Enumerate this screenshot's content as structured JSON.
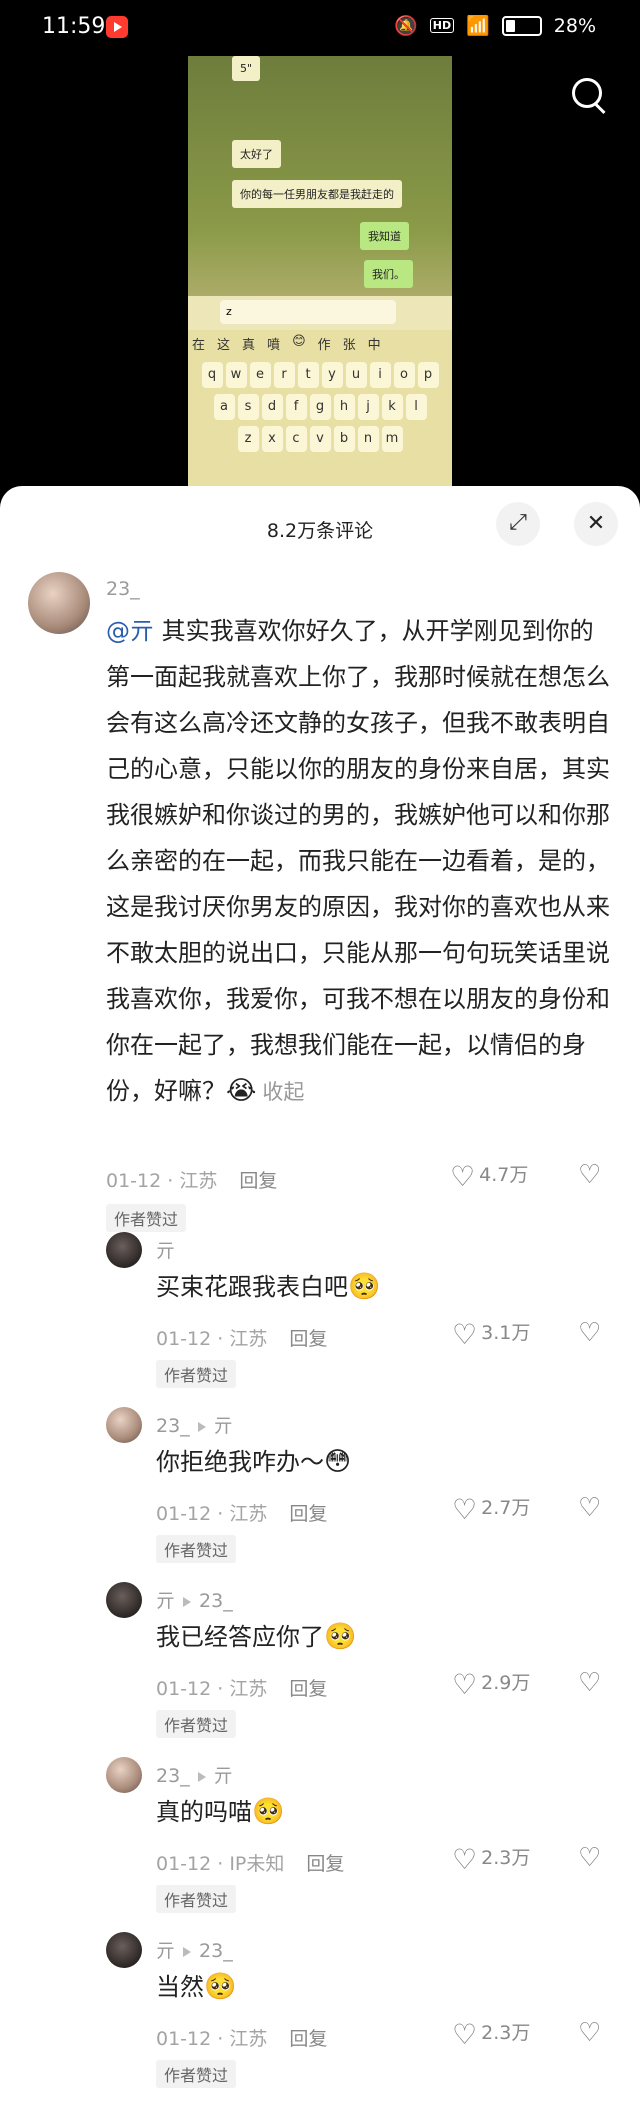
{
  "status": {
    "time": "11:59",
    "battery": "28%"
  },
  "video": {
    "bubbles": [
      "5\"",
      "太好了",
      "你的每一任男朋友都是我赶走的",
      "我知道",
      "我们。"
    ],
    "input_text": "z",
    "candidates": [
      "在",
      "这",
      "真",
      "噴",
      "😊",
      "作",
      "张",
      "中"
    ],
    "keys_row1": [
      "q",
      "w",
      "e",
      "r",
      "t",
      "y",
      "u",
      "i",
      "o",
      "p"
    ],
    "keys_row2": [
      "a",
      "s",
      "d",
      "f",
      "g",
      "h",
      "j",
      "k",
      "l"
    ],
    "keys_row3": [
      "z",
      "x",
      "c",
      "v",
      "b",
      "n",
      "m"
    ]
  },
  "sheet": {
    "title": "8.2万条评论"
  },
  "comments": [
    {
      "user": "23_",
      "mention": "@亓",
      "text": " 其实我喜欢你好久了，从开学刚见到你的第一面起我就喜欢上你了，我那时候就在想怎么会有这么高冷还文静的女孩子，但我不敢表明自己的心意，只能以你的朋友的身份来自居，其实我很嫉妒和你谈过的男的，我嫉妒他可以和你那么亲密的在一起，而我只能在一边看着，是的，这是我讨厌你男友的原因，我对你的喜欢也从来不敢太胆的说出口，只能从那一句句玩笑话里说我喜欢你，我爱你，可我不想在以朋友的身份和你在一起了，我想我们能在一起，以情侣的身份，好嘛？",
      "emoji": "😭",
      "collapse": "收起",
      "meta": "01-12 · 江苏",
      "reply": "回复",
      "likes": "4.7万",
      "badge": "作者赞过"
    }
  ],
  "replies": [
    {
      "user": "亓",
      "to": "",
      "text": "买束花跟我表白吧",
      "emoji": "🥺",
      "meta": "01-12 · 江苏",
      "reply": "回复",
      "likes": "3.1万",
      "badge": "作者赞过"
    },
    {
      "user": "23_",
      "to": "亓",
      "text": "你拒绝我咋办～",
      "emoji": "😳",
      "meta": "01-12 · 江苏",
      "reply": "回复",
      "likes": "2.7万",
      "badge": "作者赞过"
    },
    {
      "user": "亓",
      "to": "23_",
      "text": "我已经答应你了",
      "emoji": "🥺",
      "meta": "01-12 · 江苏",
      "reply": "回复",
      "likes": "2.9万",
      "badge": "作者赞过"
    },
    {
      "user": "23_",
      "to": "亓",
      "text": "真的吗喵",
      "emoji": "🥺",
      "meta": "01-12 · IP未知",
      "reply": "回复",
      "likes": "2.3万",
      "badge": "作者赞过"
    },
    {
      "user": "亓",
      "to": "23_",
      "text": "当然",
      "emoji": "🥺",
      "meta": "01-12 · 江苏",
      "reply": "回复",
      "likes": "2.3万",
      "badge": "作者赞过"
    }
  ]
}
